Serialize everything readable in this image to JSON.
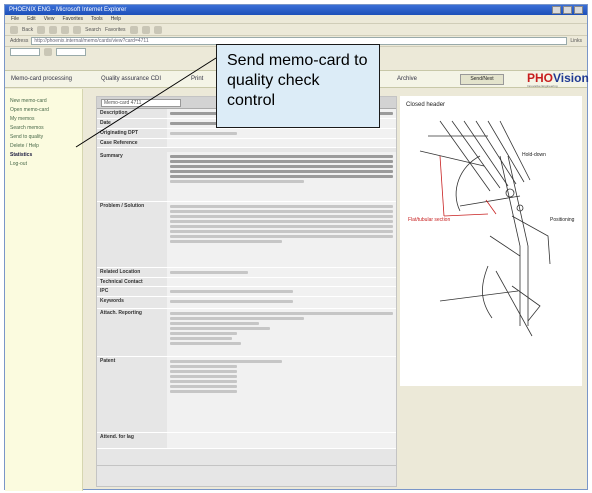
{
  "window": {
    "title": "PHOENIX ENG - Microsoft Internet Explorer",
    "menu": [
      "File",
      "Edit",
      "View",
      "Favorites",
      "Tools",
      "Help"
    ],
    "toolbar": [
      "Back",
      "Search",
      "Favorites"
    ],
    "address_label": "Address",
    "address": "http://phoenix.internal/memo/cards/view?card=4711",
    "links": "Links"
  },
  "app": {
    "tabs": [
      "Memo-card processing",
      "Quality assurance CDI",
      "Print",
      "Archive"
    ],
    "button": "Send/Next",
    "logo_a": "PHO",
    "logo_b": "Vision",
    "logo_sub": "Innovative Engineering"
  },
  "sidebar": {
    "items": [
      "New memo-card",
      "Open memo-card",
      "My memos",
      "Search memos",
      "Send to quality",
      "Delete / Help",
      "Statistics",
      "Log-out"
    ],
    "active_index": 6
  },
  "form": {
    "header": "Memo-card 4711",
    "rows": [
      {
        "label": "Description",
        "value": ""
      },
      {
        "label": "Date",
        "value": ""
      },
      {
        "label": "Originating DPT",
        "value": ""
      },
      {
        "label": "Case Reference",
        "value": ""
      },
      {
        "label": "Summary",
        "value": ""
      },
      {
        "label": "Problem / Solution",
        "value": ""
      },
      {
        "label": "Related Location",
        "value": ""
      },
      {
        "label": "Technical Contact",
        "value": ""
      },
      {
        "label": "IPC",
        "value": ""
      },
      {
        "label": "Keywords",
        "value": ""
      },
      {
        "label": "Attach. Reporting",
        "value": ""
      },
      {
        "label": "Patent",
        "value": ""
      },
      {
        "label": "Attend. for lag",
        "value": ""
      }
    ]
  },
  "figure": {
    "labels": [
      "Closed header",
      "Hold-down",
      "Flat/tubular section",
      "Positioning"
    ]
  },
  "callout": {
    "text": "Send memo-card to quality check control"
  }
}
